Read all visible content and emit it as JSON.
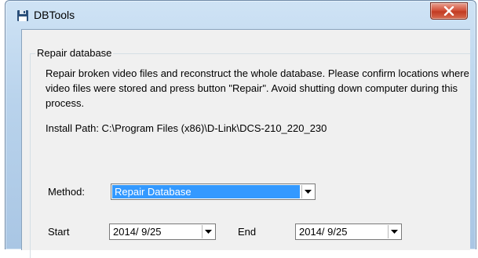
{
  "window": {
    "title": "DBTools",
    "close_label": "X"
  },
  "group": {
    "title": "Repair database",
    "description": "Repair broken video files and reconstruct the whole database. Please confirm locations where video files were stored and press button \"Repair\". Avoid shutting down computer during this process.",
    "install_path": "Install Path: C:\\Program Files (x86)\\D-Link\\DCS-210_220_230"
  },
  "method": {
    "label": "Method:",
    "value": "Repair Database"
  },
  "range": {
    "start_label": "Start",
    "start_value": "2014/ 9/25",
    "end_label": "End",
    "end_value": "2014/ 9/25"
  },
  "icons": {
    "app": "floppy-disk-icon",
    "close": "close-icon",
    "dropdown": "chevron-down-icon"
  }
}
